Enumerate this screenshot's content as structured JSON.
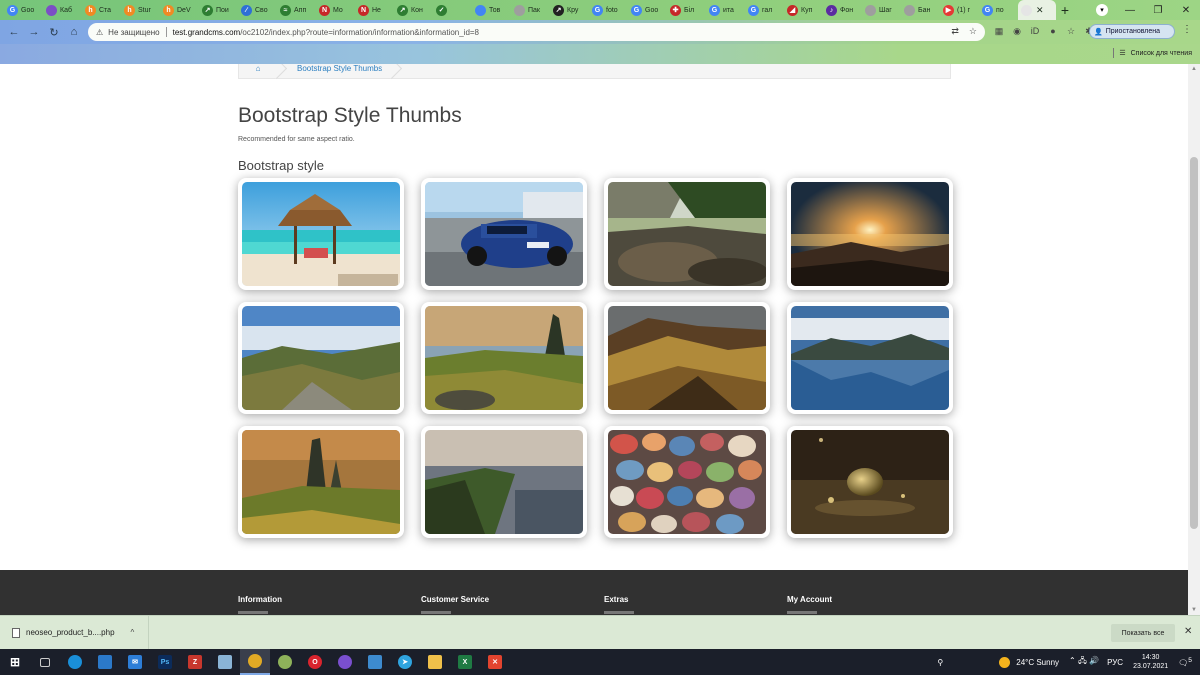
{
  "tabs": {
    "items": [
      {
        "label": "Goo",
        "color": "#4285f4",
        "glyph": "G"
      },
      {
        "label": "Каб",
        "color": "#7b4fc5",
        "glyph": ""
      },
      {
        "label": "Ста",
        "color": "#f08a24",
        "glyph": "h"
      },
      {
        "label": "Stur",
        "color": "#f08a24",
        "glyph": "h"
      },
      {
        "label": "DeV",
        "color": "#f08a24",
        "glyph": "h"
      },
      {
        "label": "Пои",
        "color": "#2e7d32",
        "glyph": "↗"
      },
      {
        "label": "Сво",
        "color": "#2e6fd6",
        "glyph": "∕"
      },
      {
        "label": "Апп",
        "color": "#2e7d32",
        "glyph": "≈"
      },
      {
        "label": "Мо",
        "color": "#c62828",
        "glyph": "N"
      },
      {
        "label": "Не",
        "color": "#c62828",
        "glyph": "N"
      },
      {
        "label": "Кон",
        "color": "#2e7d32",
        "glyph": "↗"
      },
      {
        "label": "",
        "color": "#2e7d32",
        "glyph": "✓"
      },
      {
        "label": "Тов",
        "color": "#4285f4",
        "glyph": ""
      },
      {
        "label": "Пак",
        "color": "#9e9e9e",
        "glyph": ""
      },
      {
        "label": "Кру",
        "color": "#222222",
        "glyph": "↗"
      },
      {
        "label": "foto",
        "color": "#4285f4",
        "glyph": "G"
      },
      {
        "label": "Goo",
        "color": "#4285f4",
        "glyph": "G"
      },
      {
        "label": "Біл",
        "color": "#c62828",
        "glyph": "✚"
      },
      {
        "label": "ита",
        "color": "#4285f4",
        "glyph": "G"
      },
      {
        "label": "гал",
        "color": "#4285f4",
        "glyph": "G"
      },
      {
        "label": "Куп",
        "color": "#c62828",
        "glyph": "◢"
      },
      {
        "label": "Фон",
        "color": "#5b2ca0",
        "glyph": "♪"
      },
      {
        "label": "Шаг",
        "color": "#9e9e9e",
        "glyph": ""
      },
      {
        "label": "Бан",
        "color": "#9e9e9e",
        "glyph": ""
      },
      {
        "label": "(1) г",
        "color": "#e53935",
        "glyph": "▶"
      },
      {
        "label": "по",
        "color": "#4285f4",
        "glyph": "G"
      }
    ],
    "active_tab_close": "✕",
    "new_tab": "+",
    "tab_search": "▾",
    "window_controls": {
      "minimize": "—",
      "restore": "❐",
      "close": "✕"
    }
  },
  "toolbar": {
    "back": "←",
    "forward": "→",
    "reload": "↻",
    "home": "⌂",
    "security_icon": "⚠",
    "security_label": "Не защищено",
    "url_host": "test.grandcms.com",
    "url_path": "/oc2102/index.php?route=information/information&information_id=8",
    "translate_icon": "⇄",
    "star_icon": "☆",
    "profile_label": "Приостановлена",
    "menu_icon": "⋮",
    "reading_list": "Список для чтения",
    "extensions": [
      "▦",
      "◉",
      "iD",
      "●",
      "☆",
      "✱",
      "≡"
    ]
  },
  "page": {
    "breadcrumb": {
      "home_icon": "⌂",
      "current": "Bootstrap Style Thumbs"
    },
    "title": "Bootstrap Style Thumbs",
    "subtitle": "Recommended for same aspect ratio.",
    "section_title": "Bootstrap style",
    "thumbnails": [
      {
        "subject": "beach gazebo"
      },
      {
        "subject": "blue sports car"
      },
      {
        "subject": "river rocks"
      },
      {
        "subject": "mountain sunset"
      },
      {
        "subject": "mountain valley"
      },
      {
        "subject": "Quiraing landscape"
      },
      {
        "subject": "golden hills"
      },
      {
        "subject": "mountain lake reflection"
      },
      {
        "subject": "Old Man of Storr"
      },
      {
        "subject": "coastal cliffs"
      },
      {
        "subject": "colorful pebbles"
      },
      {
        "subject": "water droplet splash"
      }
    ],
    "footer": {
      "columns": [
        "Information",
        "Customer Service",
        "Extras",
        "My Account"
      ]
    }
  },
  "downloads": {
    "file_name": "neoseo_product_b....php",
    "caret": "^",
    "show_all": "Показать все",
    "close": "✕"
  },
  "taskbar": {
    "weather": "24°C  Sunny",
    "language": "РУС",
    "time": "14:30",
    "date": "23.07.2021",
    "notification_count": "5"
  }
}
